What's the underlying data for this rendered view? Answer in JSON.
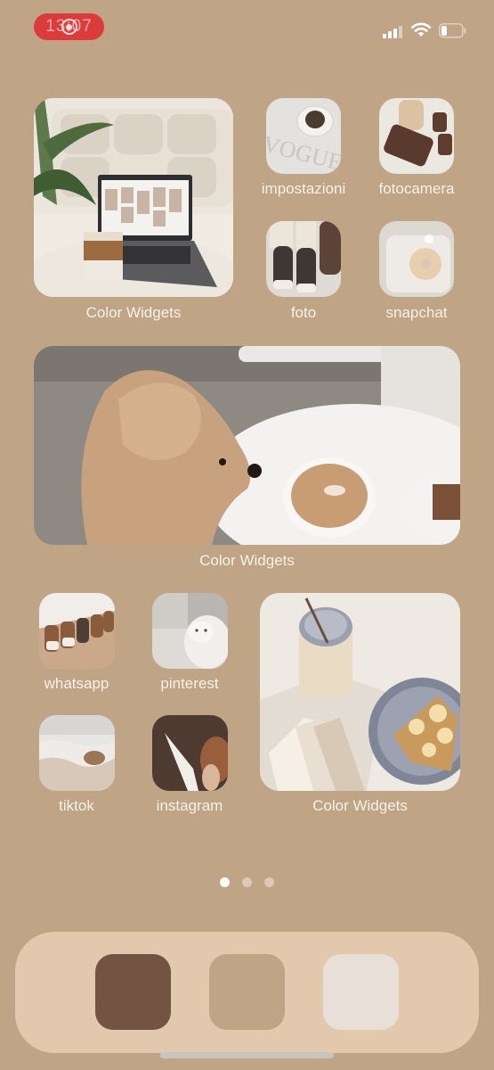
{
  "status_bar": {
    "time": "13:07",
    "recording_indicator": "screen-recording-icon",
    "recording_color": "#dc3b3b",
    "icons": [
      "cellular-signal-icon",
      "wifi-icon",
      "battery-icon"
    ]
  },
  "home_screen": {
    "background_color": "#bfa486",
    "widgets": [
      {
        "label": "Color Widgets",
        "image": "laptop-iced-coffee-photo"
      },
      {
        "label": "Color Widgets",
        "image": "poodle-latte-photo"
      },
      {
        "label": "Color Widgets",
        "image": "mason-jar-books-banana-toast-photo"
      }
    ],
    "apps": [
      {
        "label": "impostazioni",
        "image": "espresso-vogue-photo"
      },
      {
        "label": "fotocamera",
        "image": "iced-coffee-phone-case-photo"
      },
      {
        "label": "foto",
        "image": "sneakers-photo"
      },
      {
        "label": "snapchat",
        "image": "donut-box-photo"
      },
      {
        "label": "whatsapp",
        "image": "sneakers-row-photo"
      },
      {
        "label": "pinterest",
        "image": "white-cat-photo"
      },
      {
        "label": "tiktok",
        "image": "sea-waves-photo"
      },
      {
        "label": "instagram",
        "image": "angel-statue-photo"
      }
    ],
    "page_indicator": {
      "pages": 3,
      "current": 1
    }
  },
  "dock": {
    "background_color": "#e2c9ae",
    "apps": [
      {
        "name": "dock-app-1",
        "color": "#735442"
      },
      {
        "name": "dock-app-2",
        "color": "#c0a486"
      },
      {
        "name": "dock-app-3",
        "color": "#e8dfd8"
      }
    ]
  }
}
